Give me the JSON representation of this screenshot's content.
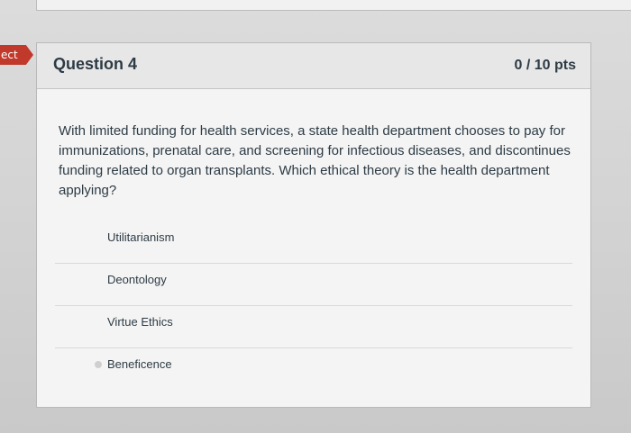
{
  "side_tag": {
    "label": "ect"
  },
  "question": {
    "title": "Question 4",
    "points": "0 / 10 pts",
    "text": "With limited funding for health services, a state health department chooses to pay for immunizations, prenatal care, and screening for infectious diseases, and discontinues funding related to organ transplants. Which ethical theory is the health department applying?",
    "answers": [
      {
        "label": "Utilitarianism",
        "selected": false
      },
      {
        "label": "Deontology",
        "selected": false
      },
      {
        "label": "Virtue Ethics",
        "selected": false
      },
      {
        "label": "Beneficence",
        "selected": true
      }
    ]
  },
  "colors": {
    "incorrect": "#c0392b",
    "text": "#2d3b45"
  }
}
